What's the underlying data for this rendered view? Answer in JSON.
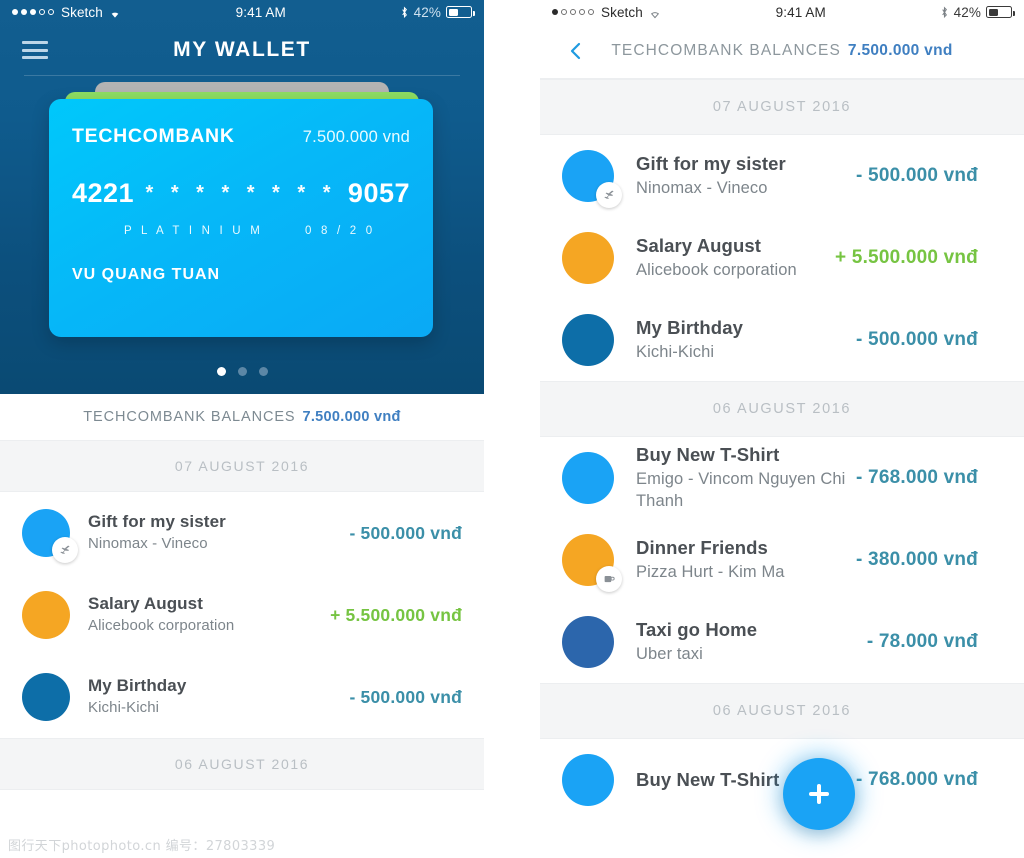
{
  "colors": {
    "hero_top": "#125e90",
    "hero_bottom": "#0a4a73",
    "card_front": "#06b8f8",
    "card_mid": "#8ede63",
    "card_back": "#b3b3b3",
    "accent_blue": "#1aa3f5",
    "amount_negative": "#3b8fa8",
    "amount_positive": "#76c442",
    "balance_value": "#3f7fc1",
    "avatar_blue": "#1aa3f5",
    "avatar_orange": "#f5a623",
    "avatar_dark_blue": "#0d6ea8",
    "avatar_navy": "#2c66ac",
    "date_sep_bg": "#f4f5f6"
  },
  "left_phone": {
    "status_bar": {
      "carrier": "Sketch",
      "time": "9:41 AM",
      "battery_percent": "42%",
      "signal_dots_filled": 3,
      "signal_dots_total": 5,
      "wifi_icon": "wifi-icon",
      "bluetooth_icon": "bluetooth-icon",
      "battery_icon": "battery-icon"
    },
    "navbar": {
      "title": "MY WALLET",
      "menu_icon": "hamburger-menu-icon"
    },
    "card": {
      "bank_name": "TECHCOMBANK",
      "balance": "7.500.000 vnd",
      "number_first": "4221",
      "number_mask_1": "* * * *",
      "number_mask_2": "* * * *",
      "number_last": "9057",
      "tier": "P L A T I N I U M",
      "expiry": "0 8 / 2 0",
      "holder": "VU QUANG TUAN"
    },
    "pager": {
      "total": 3,
      "active_index": 0
    },
    "balance_bar": {
      "label": "TECHCOMBANK BALANCES",
      "value": "7.500.000 vnđ"
    },
    "groups": [
      {
        "date": "07 AUGUST 2016",
        "transactions": [
          {
            "title": "Gift for my sister",
            "subtitle": "Ninomax - Vineco",
            "amount": "- 500.000 vnđ",
            "sign": "negative",
            "avatar_color": "#1aa3f5",
            "badge_icon": "airplane-icon"
          },
          {
            "title": "Salary August",
            "subtitle": "Alicebook corporation",
            "amount": "+ 5.500.000 vnđ",
            "sign": "positive",
            "avatar_color": "#f5a623",
            "badge_icon": null
          },
          {
            "title": "My Birthday",
            "subtitle": "Kichi-Kichi",
            "amount": "- 500.000 vnđ",
            "sign": "negative",
            "avatar_color": "#0d6ea8",
            "badge_icon": null
          }
        ]
      },
      {
        "date": "06 AUGUST 2016",
        "transactions": []
      }
    ]
  },
  "right_phone": {
    "status_bar": {
      "carrier": "Sketch",
      "time": "9:41 AM",
      "battery_percent": "42%",
      "signal_dots_filled": 1,
      "signal_dots_total": 5,
      "wifi_icon": "wifi-icon",
      "bluetooth_icon": "bluetooth-icon",
      "battery_icon": "battery-icon"
    },
    "topbar": {
      "back_icon": "chevron-left-icon",
      "label": "TECHCOMBANK BALANCES",
      "value": "7.500.000 vnd"
    },
    "groups": [
      {
        "date": "07 AUGUST 2016",
        "transactions": [
          {
            "title": "Gift for my sister",
            "subtitle": "Ninomax - Vineco",
            "amount": "- 500.000 vnđ",
            "sign": "negative",
            "avatar_color": "#1aa3f5",
            "badge_icon": "airplane-icon"
          },
          {
            "title": "Salary August",
            "subtitle": "Alicebook corporation",
            "amount": "+ 5.500.000 vnđ",
            "sign": "positive",
            "avatar_color": "#f5a623",
            "badge_icon": null
          },
          {
            "title": "My Birthday",
            "subtitle": "Kichi-Kichi",
            "amount": "- 500.000 vnđ",
            "sign": "negative",
            "avatar_color": "#0d6ea8",
            "badge_icon": null
          }
        ]
      },
      {
        "date": "06 AUGUST 2016",
        "transactions": [
          {
            "title": "Buy New T-Shirt",
            "subtitle": "Emigo - Vincom Nguyen Chi Thanh",
            "amount": "- 768.000 vnđ",
            "sign": "negative",
            "avatar_color": "#1aa3f5",
            "badge_icon": null
          },
          {
            "title": "Dinner Friends",
            "subtitle": "Pizza Hurt - Kim Ma",
            "amount": "- 380.000 vnđ",
            "sign": "negative",
            "avatar_color": "#f5a623",
            "badge_icon": "food-icon"
          },
          {
            "title": "Taxi go Home",
            "subtitle": "Uber taxi",
            "amount": "- 78.000 vnđ",
            "sign": "negative",
            "avatar_color": "#2c66ac",
            "badge_icon": null
          }
        ]
      },
      {
        "date": "06 AUGUST 2016",
        "transactions": [
          {
            "title": "Buy New T-Shirt",
            "subtitle": "",
            "amount": "- 768.000 vnđ",
            "sign": "negative",
            "avatar_color": "#1aa3f5",
            "badge_icon": null
          }
        ]
      }
    ],
    "fab": {
      "icon": "plus-icon",
      "label": "+"
    }
  },
  "watermark": "图行天下photophoto.cn  编号：27803339"
}
